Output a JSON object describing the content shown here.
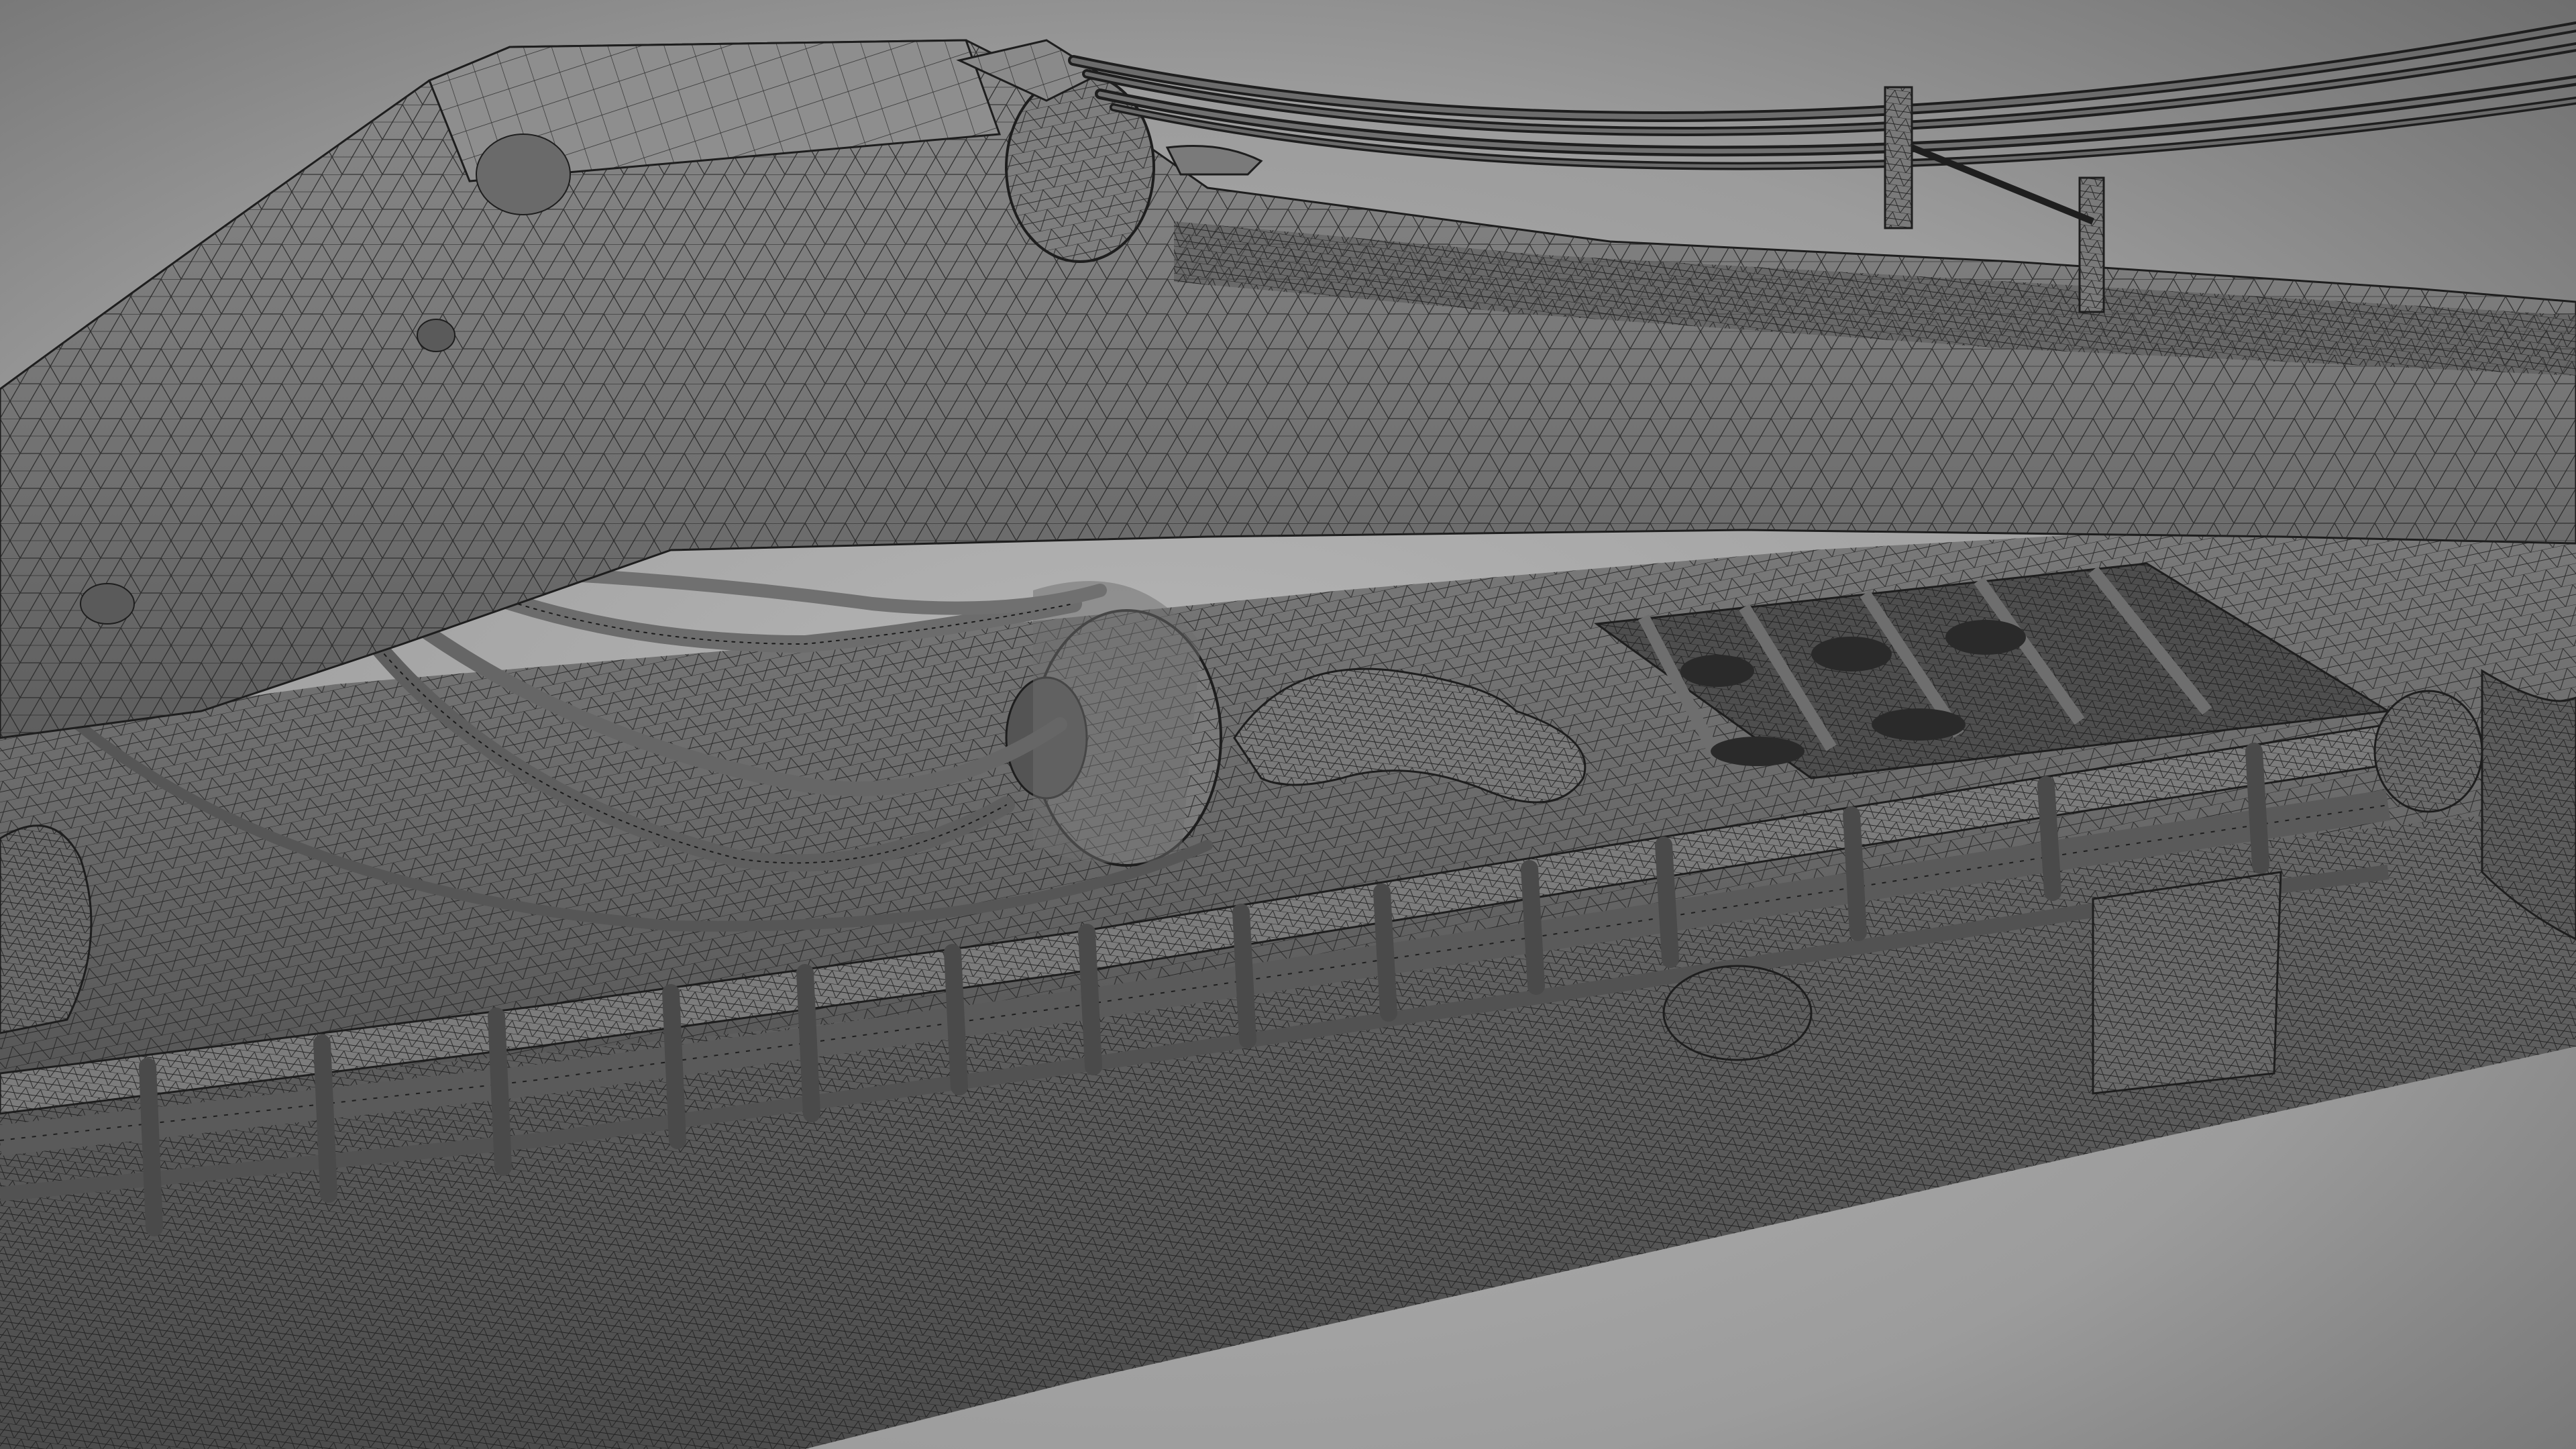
{
  "scene": {
    "subject": "wireframe-mesh-render",
    "colors": {
      "background_light": "#b3b3b3",
      "background_dark": "#6d6d6d",
      "mesh_fill": "#6e6e6e",
      "mesh_fill_light": "#858585",
      "mesh_fill_dark": "#4a4a4a",
      "wire": "#2a2a2a",
      "cable": "#1e1e1e"
    }
  }
}
